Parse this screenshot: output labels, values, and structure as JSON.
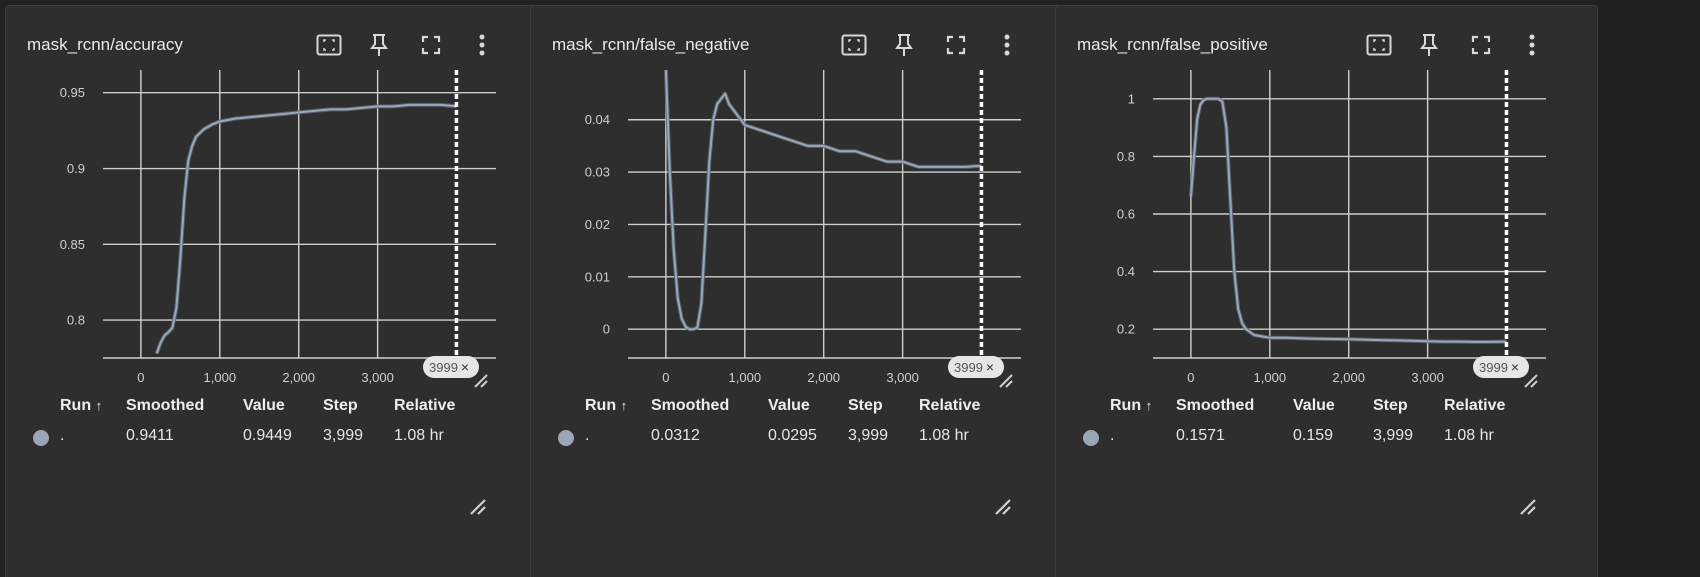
{
  "panels": [
    {
      "title": "mask_rcnn/accuracy",
      "step_badge": "3999",
      "badge_close": "×",
      "columns": [
        "Run",
        "Smoothed",
        "Value",
        "Step",
        "Relative"
      ],
      "sort_arrow": "↑",
      "row": {
        "run": ".",
        "smoothed": "0.9411",
        "value": "0.9449",
        "step": "3,999",
        "relative": "1.08 hr"
      },
      "chart_data": {
        "type": "line",
        "x_ticks": [
          "0",
          "1,000",
          "2,000",
          "3,000"
        ],
        "y_ticks": [
          "0.8",
          "0.85",
          "0.9",
          "0.95"
        ],
        "xlim": [
          -480,
          4500
        ],
        "ylim": [
          0.775,
          0.965
        ],
        "grid": true,
        "series": [
          {
            "x": [
              200,
              250,
              300,
              350,
              400,
              450,
              500,
              550,
              600,
              650,
              700,
              800,
              900,
              1000,
              1200,
              1400,
              1600,
              1800,
              2000,
              2200,
              2400,
              2600,
              2800,
              3000,
              3200,
              3400,
              3600,
              3800,
              3999
            ],
            "y": [
              0.778,
              0.785,
              0.79,
              0.792,
              0.795,
              0.808,
              0.84,
              0.88,
              0.905,
              0.915,
              0.921,
              0.926,
              0.929,
              0.931,
              0.933,
              0.934,
              0.935,
              0.936,
              0.937,
              0.938,
              0.939,
              0.939,
              0.94,
              0.941,
              0.941,
              0.942,
              0.942,
              0.942,
              0.9411
            ]
          }
        ]
      }
    },
    {
      "title": "mask_rcnn/false_negative",
      "step_badge": "3999",
      "badge_close": "×",
      "columns": [
        "Run",
        "Smoothed",
        "Value",
        "Step",
        "Relative"
      ],
      "sort_arrow": "↑",
      "row": {
        "run": ".",
        "smoothed": "0.0312",
        "value": "0.0295",
        "step": "3,999",
        "relative": "1.08 hr"
      },
      "chart_data": {
        "type": "line",
        "x_ticks": [
          "0",
          "1,000",
          "2,000",
          "3,000"
        ],
        "y_ticks": [
          "0",
          "0.01",
          "0.02",
          "0.03",
          "0.04"
        ],
        "xlim": [
          -480,
          4500
        ],
        "ylim": [
          -0.0055,
          0.0495
        ],
        "grid": true,
        "series": [
          {
            "x": [
              0,
              50,
              100,
              150,
              200,
              250,
              300,
              350,
              400,
              450,
              500,
              550,
              600,
              650,
              700,
              750,
              800,
              900,
              1000,
              1200,
              1400,
              1600,
              1800,
              2000,
              2200,
              2400,
              2600,
              2800,
              3000,
              3200,
              3400,
              3600,
              3800,
              3999
            ],
            "y": [
              0.05,
              0.03,
              0.015,
              0.006,
              0.002,
              0.0005,
              0.0,
              0.0,
              0.0003,
              0.005,
              0.018,
              0.032,
              0.04,
              0.043,
              0.044,
              0.045,
              0.043,
              0.041,
              0.039,
              0.038,
              0.037,
              0.036,
              0.035,
              0.035,
              0.034,
              0.034,
              0.033,
              0.032,
              0.032,
              0.031,
              0.031,
              0.031,
              0.031,
              0.0312
            ]
          }
        ]
      }
    },
    {
      "title": "mask_rcnn/false_positive",
      "step_badge": "3999",
      "badge_close": "×",
      "columns": [
        "Run",
        "Smoothed",
        "Value",
        "Step",
        "Relative"
      ],
      "sort_arrow": "↑",
      "row": {
        "run": ".",
        "smoothed": "0.1571",
        "value": "0.159",
        "step": "3,999",
        "relative": "1.08 hr"
      },
      "chart_data": {
        "type": "line",
        "x_ticks": [
          "0",
          "1,000",
          "2,000",
          "3,000"
        ],
        "y_ticks": [
          "0.2",
          "0.4",
          "0.6",
          "0.8",
          "1"
        ],
        "xlim": [
          -480,
          4500
        ],
        "ylim": [
          0.1,
          1.1
        ],
        "grid": true,
        "series": [
          {
            "x": [
              0,
              40,
              80,
              120,
              160,
              200,
              250,
              300,
              350,
              400,
              450,
              500,
              550,
              600,
              650,
              700,
              750,
              800,
              900,
              1000,
              1200,
              1400,
              1600,
              1800,
              2000,
              2200,
              2400,
              2600,
              2800,
              3000,
              3200,
              3400,
              3600,
              3800,
              3999
            ],
            "y": [
              0.66,
              0.8,
              0.93,
              0.98,
              0.995,
              1.0,
              1.0,
              1.0,
              1.0,
              0.99,
              0.9,
              0.65,
              0.4,
              0.27,
              0.22,
              0.2,
              0.19,
              0.18,
              0.175,
              0.17,
              0.17,
              0.168,
              0.167,
              0.166,
              0.165,
              0.164,
              0.162,
              0.161,
              0.16,
              0.158,
              0.157,
              0.157,
              0.156,
              0.156,
              0.1571
            ]
          }
        ]
      }
    }
  ]
}
